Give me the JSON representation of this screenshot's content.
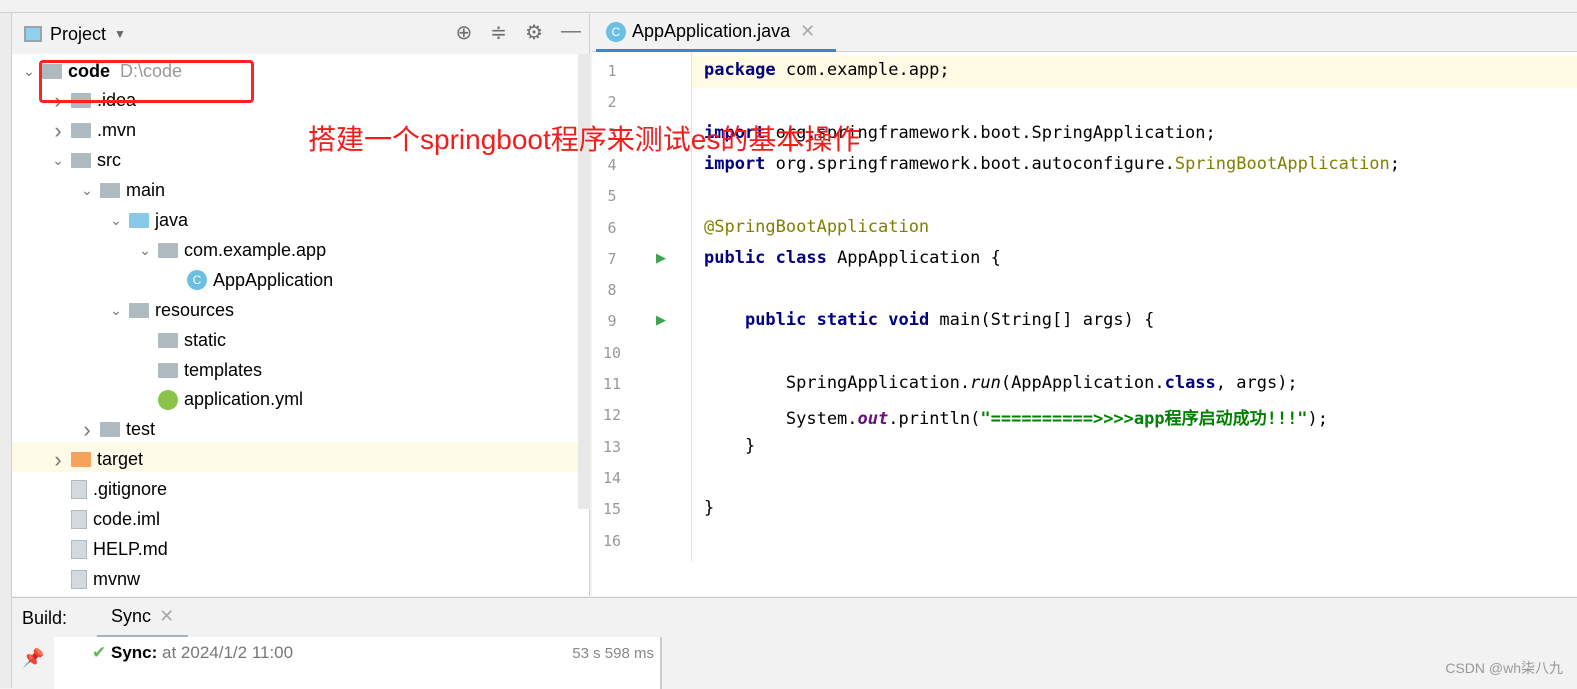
{
  "project_panel": {
    "title": "Project",
    "tree": [
      {
        "label": "code",
        "path": "D:\\code",
        "level": 0,
        "expanded": true,
        "icon": "module-folder-icon",
        "bold": true
      },
      {
        "label": ".idea",
        "level": 1,
        "expanded": false,
        "icon": "folder-icon"
      },
      {
        "label": ".mvn",
        "level": 1,
        "expanded": false,
        "icon": "folder-icon"
      },
      {
        "label": "src",
        "level": 1,
        "expanded": true,
        "icon": "folder-icon"
      },
      {
        "label": "main",
        "level": 2,
        "expanded": true,
        "icon": "folder-icon"
      },
      {
        "label": "java",
        "level": 3,
        "expanded": true,
        "icon": "source-folder-icon"
      },
      {
        "label": "com.example.app",
        "level": 4,
        "expanded": true,
        "icon": "package-icon"
      },
      {
        "label": "AppApplication",
        "level": 5,
        "icon": "spring-class-icon"
      },
      {
        "label": "resources",
        "level": 3,
        "expanded": true,
        "icon": "resources-folder-icon"
      },
      {
        "label": "static",
        "level": 4,
        "icon": "folder-icon"
      },
      {
        "label": "templates",
        "level": 4,
        "icon": "folder-icon"
      },
      {
        "label": "application.yml",
        "level": 4,
        "icon": "spring-config-icon"
      },
      {
        "label": "test",
        "level": 2,
        "expanded": false,
        "icon": "folder-icon"
      },
      {
        "label": "target",
        "level": 1,
        "expanded": false,
        "icon": "excluded-folder-icon"
      },
      {
        "label": ".gitignore",
        "level": 1,
        "icon": "file-icon"
      },
      {
        "label": "code.iml",
        "level": 1,
        "icon": "file-icon"
      },
      {
        "label": "HELP.md",
        "level": 1,
        "icon": "markdown-icon"
      },
      {
        "label": "mvnw",
        "level": 1,
        "icon": "script-icon"
      }
    ]
  },
  "editor": {
    "tab": "AppApplication.java",
    "lines": [
      [
        {
          "t": "package ",
          "c": "kw"
        },
        {
          "t": "com.example.app;"
        }
      ],
      [],
      [
        {
          "t": "import ",
          "c": "kw"
        },
        {
          "t": "org.springframework.boot.SpringApplication;"
        }
      ],
      [
        {
          "t": "import ",
          "c": "kw"
        },
        {
          "t": "org.springframework.boot.autoconfigure."
        },
        {
          "t": "SpringBootApplication",
          "c": "ol"
        },
        {
          "t": ";"
        }
      ],
      [],
      [
        {
          "t": "@SpringBootApplication",
          "c": "an"
        }
      ],
      [
        {
          "t": "public class ",
          "c": "kw"
        },
        {
          "t": "AppApplication {"
        }
      ],
      [],
      [
        {
          "t": "    "
        },
        {
          "t": "public static void ",
          "c": "kw"
        },
        {
          "t": "main(String[] args) {"
        }
      ],
      [],
      [
        {
          "t": "        SpringApplication."
        },
        {
          "t": "run",
          "c": "ital"
        },
        {
          "t": "(AppApplication."
        },
        {
          "t": "class",
          "c": "kw"
        },
        {
          "t": ", args);"
        }
      ],
      [
        {
          "t": "        System."
        },
        {
          "t": "out",
          "c": "it"
        },
        {
          "t": ".println("
        },
        {
          "t": "\"==========>>>>app程序启动成功!!!\"",
          "c": "st"
        },
        {
          "t": ");"
        }
      ],
      [
        {
          "t": "    }"
        }
      ],
      [],
      [
        {
          "t": "}"
        }
      ],
      []
    ]
  },
  "annotation": "搭建一个springboot程序来测试es的基本操作",
  "build": {
    "label": "Build:",
    "tab": "Sync",
    "status": "Sync:",
    "time": "at 2024/1/2 11:00",
    "duration": "53 s 598 ms"
  },
  "watermark": "CSDN @wh柒八九"
}
